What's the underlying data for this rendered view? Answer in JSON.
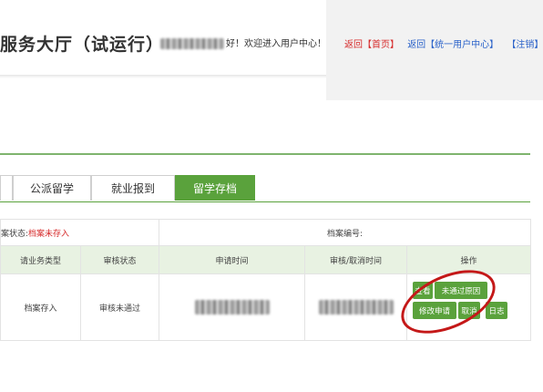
{
  "header": {
    "title": "服务大厅（试运行）",
    "welcome_suffix": "好！欢迎进入用户中心！",
    "links": [
      {
        "label": "返回【首页】",
        "color": "#d62b2b"
      },
      {
        "label": "返回【统一用户中心】",
        "color": "#2a62c9"
      },
      {
        "label": "【注销】",
        "color": "#2a62c9"
      }
    ]
  },
  "tabs": [
    {
      "label": ""
    },
    {
      "label": "公派留学"
    },
    {
      "label": "就业报到"
    },
    {
      "label": "留学存档",
      "active": true
    }
  ],
  "info": {
    "status_label": "案状态:",
    "status_value": "档案未存入",
    "archive_no_label": "档案编号:"
  },
  "table": {
    "columns": [
      "请业务类型",
      "审核状态",
      "申请时间",
      "审核/取消时间",
      "操作"
    ],
    "row": {
      "type": "档案存入",
      "status": "审核未通过"
    },
    "buttons": [
      {
        "label": "查看"
      },
      {
        "label": "未通过原因"
      },
      {
        "label": "修改申请"
      },
      {
        "label": "取消"
      },
      {
        "label": "日志"
      }
    ]
  },
  "colors": {
    "accent": "#5aa23c",
    "header_bg": "#e8f2e2",
    "annotation": "#c41818"
  }
}
